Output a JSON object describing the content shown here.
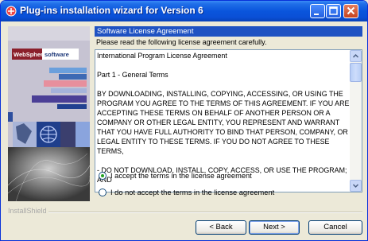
{
  "window": {
    "title": "Plug-ins installation wizard for Version 6"
  },
  "left_panel": {
    "logo_brand": "WebSphere",
    "logo_word": "software"
  },
  "content": {
    "banner": "Software License Agreement",
    "instruction": "Please read the following license agreement carefully.",
    "license_paragraphs": [
      "International Program License Agreement",
      "Part 1 - General Terms",
      "BY DOWNLOADING, INSTALLING, COPYING, ACCESSING, OR USING THE PROGRAM YOU AGREE TO THE TERMS OF THIS AGREEMENT. IF YOU ARE ACCEPTING THESE TERMS ON BEHALF OF ANOTHER PERSON OR A COMPANY OR OTHER LEGAL ENTITY, YOU REPRESENT AND WARRANT THAT YOU HAVE FULL AUTHORITY TO BIND THAT PERSON, COMPANY, OR LEGAL ENTITY TO THESE TERMS. IF YOU DO NOT AGREE TO THESE TERMS,",
      "- DO NOT DOWNLOAD, INSTALL, COPY, ACCESS, OR USE THE PROGRAM; AND"
    ]
  },
  "options": {
    "accept": "I accept the terms in the license agreement",
    "decline": "I do not accept the terms in the license agreement",
    "selected": "accept"
  },
  "footer": {
    "brand": "InstallShield",
    "back": "< Back",
    "next": "Next >",
    "cancel": "Cancel"
  }
}
